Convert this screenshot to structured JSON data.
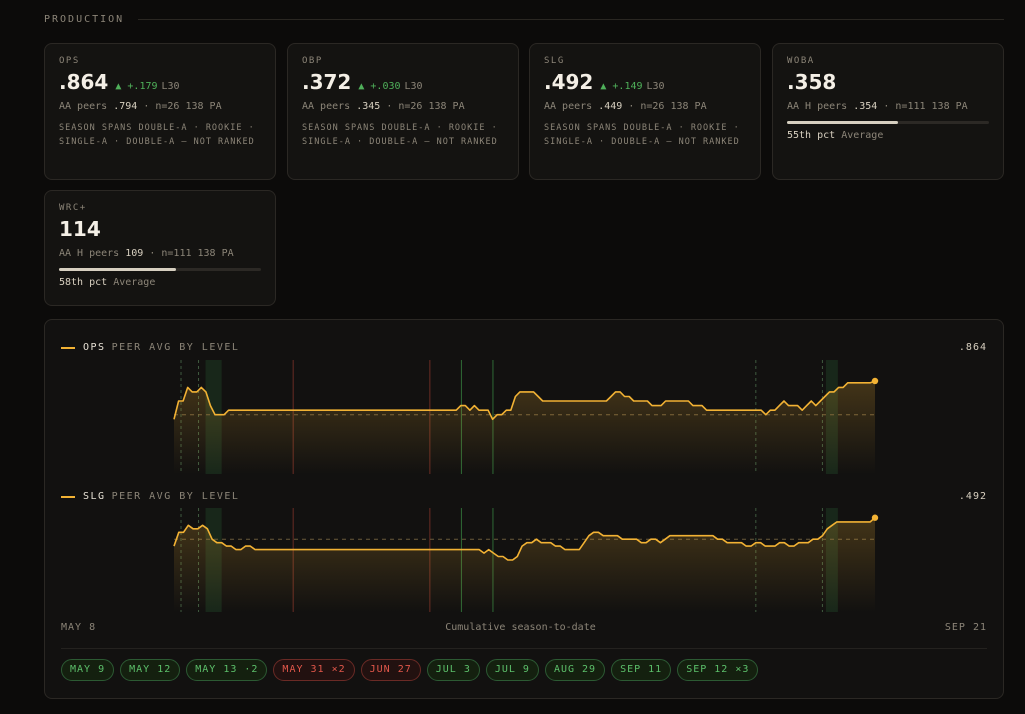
{
  "section": {
    "title": "PRODUCTION"
  },
  "cards": [
    {
      "label": "OPS",
      "value": ".864",
      "delta": "▲ +.179",
      "window": "L30",
      "peers_prefix": "AA peers",
      "peers_value": ".794",
      "peers_suffix": "· n=26  138 PA",
      "note": "SEASON SPANS DOUBLE-A · ROOKIE · SINGLE-A · DOUBLE-A — NOT RANKED"
    },
    {
      "label": "OBP",
      "value": ".372",
      "delta": "▲ +.030",
      "window": "L30",
      "peers_prefix": "AA peers",
      "peers_value": ".345",
      "peers_suffix": "· n=26  138 PA",
      "note": "SEASON SPANS DOUBLE-A · ROOKIE · SINGLE-A · DOUBLE-A — NOT RANKED"
    },
    {
      "label": "SLG",
      "value": ".492",
      "delta": "▲ +.149",
      "window": "L30",
      "peers_prefix": "AA peers",
      "peers_value": ".449",
      "peers_suffix": "· n=26  138 PA",
      "note": "SEASON SPANS DOUBLE-A · ROOKIE · SINGLE-A · DOUBLE-A — NOT RANKED"
    },
    {
      "label": "WOBA",
      "value": ".358",
      "peers_prefix": "AA H peers",
      "peers_value": ".354",
      "peers_suffix": "· n=111  138 PA",
      "percentile": 55,
      "pct_label": "55th pct",
      "pct_desc": "Average"
    },
    {
      "label": "WRC+",
      "value": "114",
      "peers_prefix": "AA H peers",
      "peers_value": "109",
      "peers_suffix": "· n=111  138 PA",
      "percentile": 58,
      "pct_label": "58th pct",
      "pct_desc": "Average"
    }
  ],
  "charts": [
    {
      "metric": "OPS",
      "subtitle": "PEER AVG BY LEVEL",
      "last_value": ".864",
      "color": "#f2b234",
      "peer_avg": 0.79,
      "ylim": [
        0.66,
        0.91
      ],
      "series": [
        0.78,
        0.82,
        0.82,
        0.85,
        0.84,
        0.84,
        0.85,
        0.84,
        0.81,
        0.79,
        0.79,
        0.79,
        0.8,
        0.8,
        0.8,
        0.8,
        0.8,
        0.8,
        0.8,
        0.8,
        0.8,
        0.8,
        0.8,
        0.8,
        0.8,
        0.8,
        0.8,
        0.8,
        0.8,
        0.8,
        0.8,
        0.8,
        0.8,
        0.8,
        0.8,
        0.8,
        0.8,
        0.8,
        0.8,
        0.8,
        0.8,
        0.8,
        0.8,
        0.8,
        0.8,
        0.8,
        0.8,
        0.8,
        0.8,
        0.8,
        0.8,
        0.8,
        0.8,
        0.8,
        0.8,
        0.8,
        0.8,
        0.8,
        0.8,
        0.8,
        0.8,
        0.8,
        0.8,
        0.81,
        0.81,
        0.8,
        0.81,
        0.8,
        0.8,
        0.8,
        0.78,
        0.79,
        0.79,
        0.8,
        0.8,
        0.83,
        0.84,
        0.84,
        0.84,
        0.84,
        0.83,
        0.82,
        0.82,
        0.82,
        0.82,
        0.82,
        0.82,
        0.82,
        0.82,
        0.82,
        0.82,
        0.82,
        0.82,
        0.82,
        0.82,
        0.82,
        0.83,
        0.84,
        0.84,
        0.83,
        0.83,
        0.82,
        0.82,
        0.82,
        0.82,
        0.81,
        0.81,
        0.81,
        0.82,
        0.82,
        0.82,
        0.82,
        0.82,
        0.82,
        0.81,
        0.81,
        0.81,
        0.8,
        0.8,
        0.8,
        0.8,
        0.8,
        0.8,
        0.8,
        0.8,
        0.8,
        0.8,
        0.8,
        0.8,
        0.8,
        0.79,
        0.8,
        0.8,
        0.81,
        0.82,
        0.81,
        0.81,
        0.81,
        0.8,
        0.81,
        0.82,
        0.81,
        0.82,
        0.83,
        0.84,
        0.84,
        0.85,
        0.85,
        0.86,
        0.86,
        0.86,
        0.86,
        0.86,
        0.86,
        0.864
      ]
    },
    {
      "metric": "SLG",
      "subtitle": "PEER AVG BY LEVEL",
      "last_value": ".492",
      "color": "#f2b234",
      "peer_avg": 0.43,
      "ylim": [
        0.22,
        0.52
      ],
      "series": [
        0.41,
        0.45,
        0.45,
        0.47,
        0.46,
        0.46,
        0.47,
        0.46,
        0.43,
        0.42,
        0.42,
        0.41,
        0.41,
        0.4,
        0.4,
        0.41,
        0.41,
        0.4,
        0.4,
        0.4,
        0.4,
        0.4,
        0.4,
        0.4,
        0.4,
        0.4,
        0.4,
        0.4,
        0.4,
        0.4,
        0.4,
        0.4,
        0.4,
        0.4,
        0.4,
        0.4,
        0.4,
        0.4,
        0.4,
        0.4,
        0.4,
        0.4,
        0.4,
        0.4,
        0.4,
        0.4,
        0.4,
        0.4,
        0.4,
        0.4,
        0.4,
        0.4,
        0.4,
        0.4,
        0.4,
        0.4,
        0.4,
        0.4,
        0.4,
        0.4,
        0.4,
        0.4,
        0.4,
        0.4,
        0.4,
        0.39,
        0.4,
        0.39,
        0.38,
        0.38,
        0.37,
        0.37,
        0.38,
        0.41,
        0.42,
        0.42,
        0.43,
        0.42,
        0.42,
        0.42,
        0.41,
        0.41,
        0.4,
        0.4,
        0.4,
        0.4,
        0.42,
        0.44,
        0.45,
        0.45,
        0.44,
        0.44,
        0.44,
        0.44,
        0.43,
        0.43,
        0.43,
        0.43,
        0.42,
        0.42,
        0.43,
        0.43,
        0.42,
        0.43,
        0.44,
        0.44,
        0.44,
        0.44,
        0.44,
        0.44,
        0.44,
        0.44,
        0.44,
        0.44,
        0.43,
        0.43,
        0.42,
        0.42,
        0.42,
        0.42,
        0.41,
        0.41,
        0.42,
        0.42,
        0.41,
        0.41,
        0.41,
        0.42,
        0.42,
        0.41,
        0.41,
        0.42,
        0.42,
        0.42,
        0.43,
        0.43,
        0.44,
        0.46,
        0.47,
        0.48,
        0.48,
        0.48,
        0.48,
        0.48,
        0.48,
        0.48,
        0.48,
        0.492
      ]
    }
  ],
  "markers": [
    {
      "frac": 0.01,
      "kind": "dash"
    },
    {
      "frac": 0.035,
      "kind": "dash"
    },
    {
      "frac": 0.045,
      "kind": "band",
      "to": 0.068
    },
    {
      "frac": 0.17,
      "kind": "red"
    },
    {
      "frac": 0.365,
      "kind": "red"
    },
    {
      "frac": 0.41,
      "kind": "green"
    },
    {
      "frac": 0.455,
      "kind": "green"
    },
    {
      "frac": 0.83,
      "kind": "dash"
    },
    {
      "frac": 0.925,
      "kind": "dash"
    },
    {
      "frac": 0.93,
      "kind": "band",
      "to": 0.947
    }
  ],
  "axis": {
    "start": "MAY 8",
    "middle": "Cumulative season-to-date",
    "end": "SEP 21"
  },
  "chips": [
    {
      "label": "MAY 9",
      "tone": "green"
    },
    {
      "label": "MAY 12",
      "tone": "green"
    },
    {
      "label": "MAY 13 ·2",
      "tone": "green"
    },
    {
      "label": "MAY 31 ×2",
      "tone": "red"
    },
    {
      "label": "JUN 27",
      "tone": "red"
    },
    {
      "label": "JUL 3",
      "tone": "green"
    },
    {
      "label": "JUL 9",
      "tone": "green"
    },
    {
      "label": "AUG 29",
      "tone": "green"
    },
    {
      "label": "SEP 11",
      "tone": "green"
    },
    {
      "label": "SEP 12 ×3",
      "tone": "green"
    }
  ]
}
